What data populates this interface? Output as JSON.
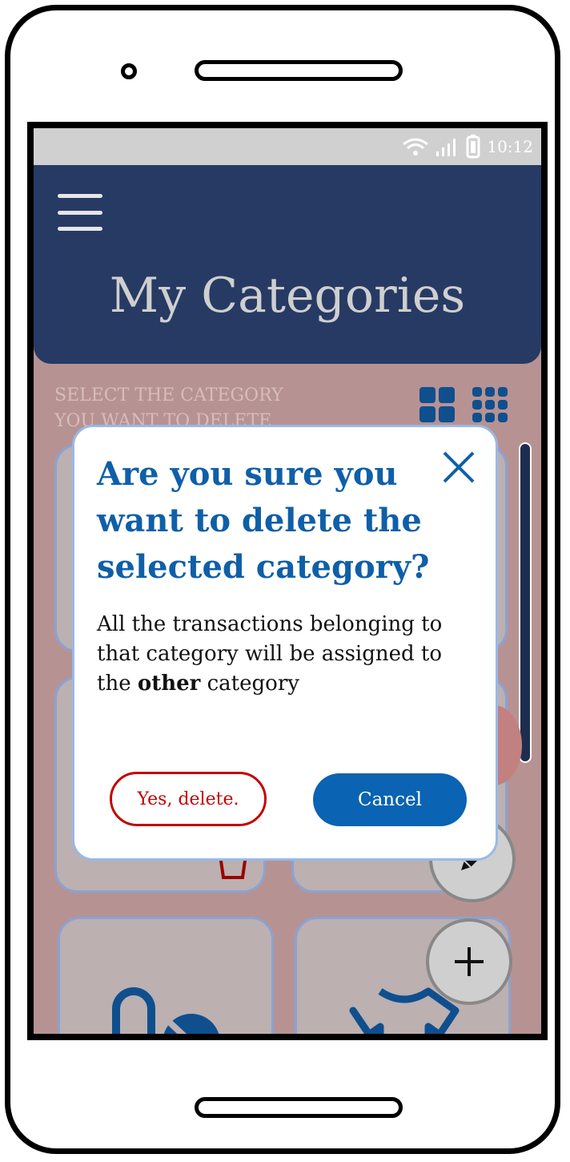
{
  "status_bar": {
    "time": "10:12"
  },
  "header": {
    "title": "My Categories"
  },
  "instruction": {
    "line1": "SELECT THE CATEGORY",
    "line2": "YOU WANT TO DELETE"
  },
  "dialog": {
    "title": "Are you sure you want to delete the selected category?",
    "message_before": "All the transactions belonging to that category will be assigned to the ",
    "message_bold": "other",
    "message_after": " category",
    "confirm_label": "Yes, delete.",
    "cancel_label": "Cancel"
  },
  "colors": {
    "header": "#263a64",
    "accent": "#0f5fa8",
    "danger": "#c40000",
    "overlay": "#b79292"
  },
  "icons": [
    "wifi-icon",
    "signal-icon",
    "battery-icon",
    "menu-icon",
    "grid-2x2-icon",
    "grid-3x3-icon",
    "close-icon",
    "pencil-icon",
    "plus-icon",
    "pill-icon",
    "tshirt-icon",
    "shopping-bag-icon"
  ]
}
